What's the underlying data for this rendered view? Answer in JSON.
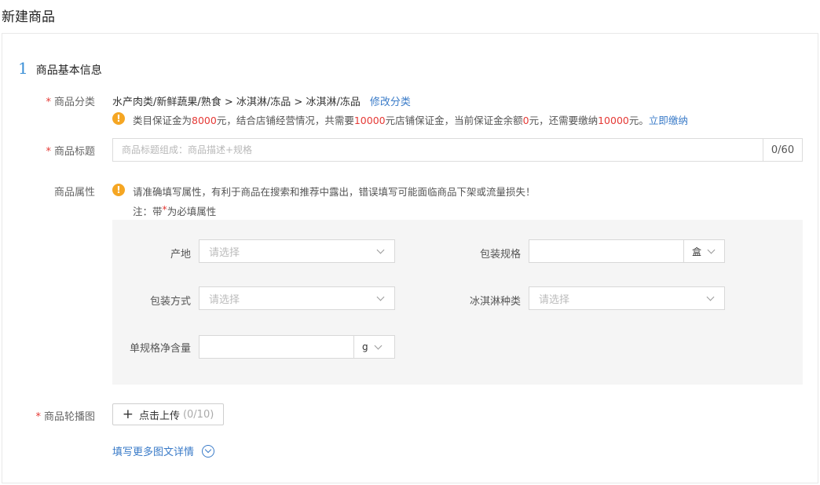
{
  "page": {
    "title": "新建商品"
  },
  "section": {
    "number": "1",
    "title": "商品基本信息"
  },
  "category": {
    "label": "商品分类",
    "path": "水产肉类/新鲜蔬果/熟食 > 冰淇淋/冻品 > 冰淇淋/冻品",
    "modify_link": "修改分类",
    "notice": {
      "p1": "类目保证金为",
      "amount1": "8000",
      "p2": "元，结合店铺经营情况，共需要",
      "amount2": "10000",
      "p3": "元店铺保证金，当前保证金余额",
      "amount3": "0",
      "p4": "元，还需要缴纳",
      "amount4": "10000",
      "p5": "元。",
      "pay_link": "立即缴纳"
    }
  },
  "title_field": {
    "label": "商品标题",
    "placeholder": "商品标题组成：商品描述+规格",
    "value": "",
    "counter": "0/60"
  },
  "attributes": {
    "label": "商品属性",
    "warning": "请准确填写属性，有利于商品在搜索和推荐中露出，错误填写可能面临商品下架或流量损失！",
    "note_prefix": "注：带",
    "note_star": "*",
    "note_suffix": "为必填属性",
    "origin": {
      "label": "产地",
      "placeholder": "请选择"
    },
    "package_spec": {
      "label": "包装规格",
      "value": "",
      "unit": "盒"
    },
    "package_method": {
      "label": "包装方式",
      "placeholder": "请选择"
    },
    "icecream_type": {
      "label": "冰淇淋种类",
      "placeholder": "请选择"
    },
    "net_content": {
      "label": "单规格净含量",
      "value": "",
      "unit": "g"
    }
  },
  "carousel": {
    "label": "商品轮播图",
    "plus": "+",
    "upload_label": "点击上传",
    "count": "(0/10)"
  },
  "more_details": {
    "label": "填写更多图文详情"
  },
  "colors": {
    "link": "#3a7bc8",
    "required": "#e53935",
    "warning": "#f5a623",
    "section_number": "#3a8fd6"
  }
}
